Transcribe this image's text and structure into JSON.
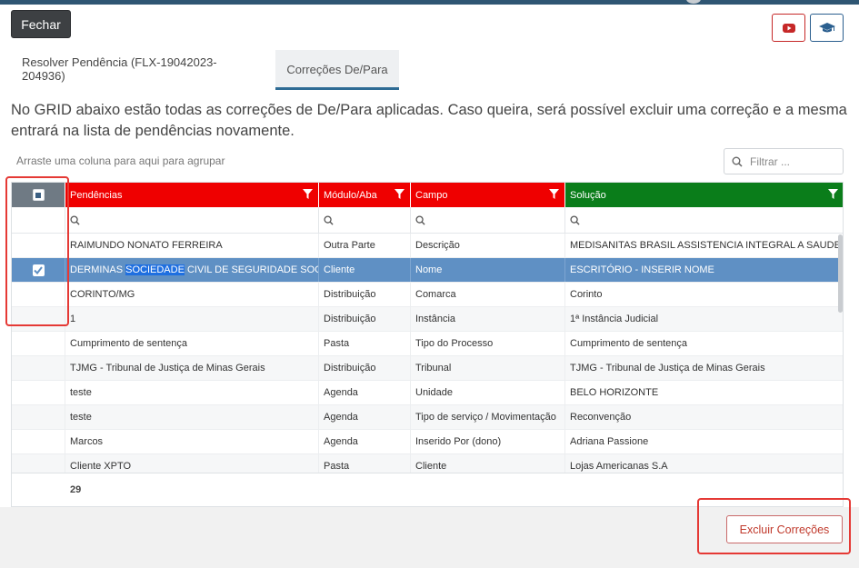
{
  "header": {
    "close_label": "Fechar",
    "youtube_icon": "youtube-icon",
    "help_icon": "graduation-cap-icon"
  },
  "tabs": [
    {
      "label": "Resolver Pendência (FLX-19042023-204936)",
      "active": false
    },
    {
      "label": "Correções De/Para",
      "active": true
    }
  ],
  "info_text": "No GRID abaixo estão todas as correções de De/Para aplicadas. Caso queira, será possível excluir uma correção e a mesma entrará na lista de pendências novamente.",
  "group_hint": "Arraste uma coluna para aqui para agrupar",
  "filter": {
    "placeholder": "Filtrar ..."
  },
  "grid": {
    "columns": [
      {
        "label": "Pendências",
        "color": "#ef0000"
      },
      {
        "label": "Módulo/Aba",
        "color": "#ef0000"
      },
      {
        "label": "Campo",
        "color": "#ef0000"
      },
      {
        "label": "Solução",
        "color": "#0a7d1a"
      }
    ],
    "rows": [
      {
        "pendencia": "RAIMUNDO NONATO FERREIRA",
        "modulo": "Outra Parte",
        "campo": "Descrição",
        "solucao": "MEDISANITAS BRASIL ASSISTENCIA INTEGRAL A SAUDE S/A",
        "checked": false
      },
      {
        "pendencia_pre": "DERMINAS ",
        "pendencia_hl": "SOCIEDADE",
        "pendencia_post": " CIVIL DE SEGURIDADE SOCIAL",
        "modulo": "Cliente",
        "campo": "Nome",
        "solucao": "ESCRITÓRIO - INSERIR NOME",
        "checked": true
      },
      {
        "pendencia": "CORINTO/MG",
        "modulo": "Distribuição",
        "campo": "Comarca",
        "solucao": "Corinto",
        "checked": false
      },
      {
        "pendencia": "1",
        "modulo": "Distribuição",
        "campo": "Instância",
        "solucao": "1ª Instância Judicial",
        "checked": false
      },
      {
        "pendencia": "Cumprimento de sentença",
        "modulo": "Pasta",
        "campo": "Tipo do Processo",
        "solucao": "Cumprimento de sentença",
        "checked": false
      },
      {
        "pendencia": "TJMG - Tribunal de Justiça de Minas Gerais",
        "modulo": "Distribuição",
        "campo": "Tribunal",
        "solucao": "TJMG - Tribunal de Justiça de Minas Gerais",
        "checked": false
      },
      {
        "pendencia": "teste",
        "modulo": "Agenda",
        "campo": "Unidade",
        "solucao": "BELO HORIZONTE",
        "checked": false
      },
      {
        "pendencia": "teste",
        "modulo": "Agenda",
        "campo": "Tipo de serviço / Movimentação",
        "solucao": "Reconvenção",
        "checked": false
      },
      {
        "pendencia": "Marcos",
        "modulo": "Agenda",
        "campo": "Inserido Por (dono)",
        "solucao": "Adriana Passione",
        "checked": false
      },
      {
        "pendencia": "Cliente XPTO",
        "modulo": "Pasta",
        "campo": "Cliente",
        "solucao": "Lojas Americanas S.A",
        "checked": false
      }
    ],
    "total_count": "29"
  },
  "actions": {
    "delete_label": "Excluir Correções"
  }
}
